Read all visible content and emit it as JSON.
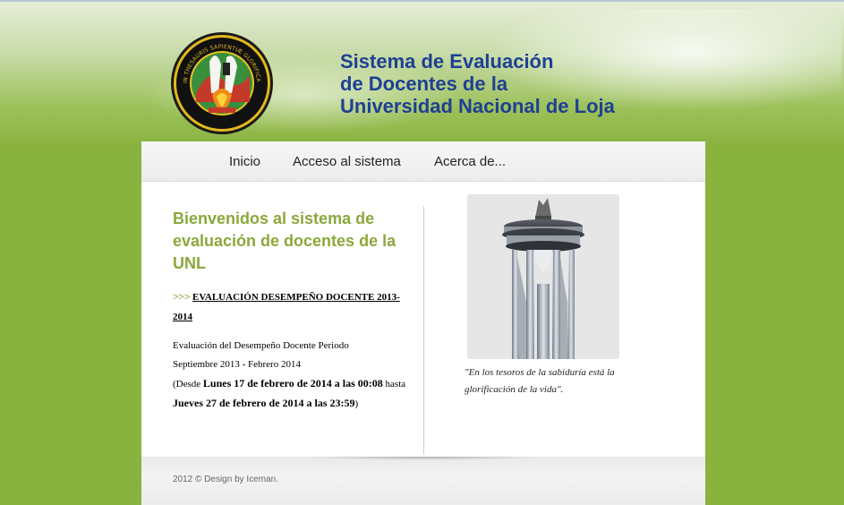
{
  "header": {
    "title_lines": [
      "Sistema de Evaluación",
      "de Docentes de la",
      "Universidad Nacional de Loja"
    ],
    "logo_name": "unl-seal-logo",
    "logo_motto": "IN THESAURIS SAPIENTIÆ GLORIFICATIO VITÆ"
  },
  "nav": {
    "items": [
      "Inicio",
      "Acceso al sistema",
      "Acerca de..."
    ]
  },
  "main": {
    "welcome": "Bienvenidos al sistema de evaluación de docentes de la UNL",
    "link_prefix": ">>>",
    "link_text": "EVALUACIÓN DESEMPEÑO DOCENTE 2013-2014",
    "period_line1": "Evaluación del Desempeño Docente Periodo",
    "period_line2": "Septiembre 2013 - Febrero 2014",
    "period_from_prefix": "(Desde ",
    "period_from": "Lunes 17 de febrero de 2014 a las 00:08",
    "period_mid": " hasta ",
    "period_to": "Jueves 27 de febrero de 2014 a las 23:59",
    "period_end": ")"
  },
  "sidebar": {
    "image_name": "university-tower-image",
    "quote": "\"En los tesoros de la sabiduría está la glorificación de la vida\"."
  },
  "footer": {
    "text": "2012 © Design by Iceman."
  },
  "colors": {
    "title_blue": "#1f3f95",
    "accent_green": "#8aa83c",
    "background_green": "#8ab23e"
  }
}
